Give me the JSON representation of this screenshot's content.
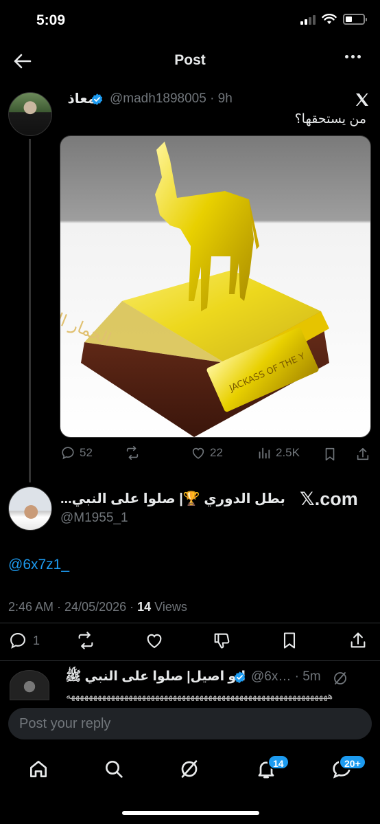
{
  "status_bar": {
    "time": "5:09"
  },
  "header": {
    "title": "Post"
  },
  "quoted_post": {
    "author_name": "معاذ",
    "handle_time": "@madh1898005 · 9h",
    "text": "من يستحقها؟",
    "image_caption_ar": "الحمار الذهبي",
    "image_plate_text": "JACKASS OF THE Y",
    "platform_icon": "x-logo",
    "stats": {
      "replies": "52",
      "likes": "22",
      "views": "2.5K"
    }
  },
  "reply_post": {
    "author_name": "بطل الدوري 🏆| صلوا على النبي...",
    "handle": "@M1955_1",
    "watermark": "𝕏.com",
    "mention": "@6x7z1_",
    "time_date": "2:46 AM · 24/05/2026 · ",
    "views_count": "14",
    "views_label": " Views",
    "stats": {
      "replies": "1"
    }
  },
  "next_reply": {
    "author_name": "ابو اصيل| صلوا على النبي ﷺ",
    "handle_time": "@6x… · 5m",
    "text": "هههههههههههههههههههههههههههههههههههههههههههههههههههههههههههه"
  },
  "compose": {
    "placeholder": "Post your reply"
  },
  "bottom_nav": {
    "notifications_badge": "14",
    "messages_badge": "20+"
  },
  "colors": {
    "accent": "#1d9bf0",
    "background": "#000000",
    "muted": "#71767b",
    "verified": "#1d9bf0"
  }
}
